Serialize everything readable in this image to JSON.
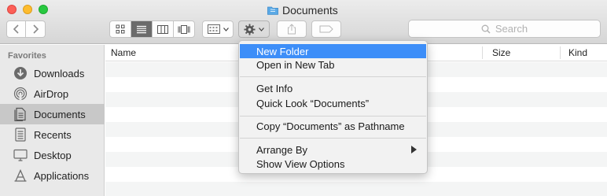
{
  "window": {
    "title": "Documents",
    "colors": {
      "close": "#fc5f57",
      "minimize": "#fdbc2e",
      "maximize": "#28c840",
      "accent": "#3d8ef8",
      "folder": "#5aa9e6"
    }
  },
  "toolbar": {
    "back_icon": "chevron-left-icon",
    "forward_icon": "chevron-right-icon",
    "view_modes": [
      "icon-view",
      "list-view",
      "column-view",
      "cover-flow-view"
    ],
    "active_view": "list-view",
    "group_icon": "group-grid-icon",
    "action_icon": "gear-icon",
    "share_icon": "share-icon",
    "tag_icon": "tag-icon"
  },
  "search": {
    "placeholder": "Search",
    "icon": "search-icon"
  },
  "sidebar": {
    "heading": "Favorites",
    "items": [
      {
        "label": "Downloads",
        "icon": "downloads-icon",
        "selected": false
      },
      {
        "label": "AirDrop",
        "icon": "airdrop-icon",
        "selected": false
      },
      {
        "label": "Documents",
        "icon": "documents-icon",
        "selected": true
      },
      {
        "label": "Recents",
        "icon": "recents-icon",
        "selected": false
      },
      {
        "label": "Desktop",
        "icon": "desktop-icon",
        "selected": false
      },
      {
        "label": "Applications",
        "icon": "applications-icon",
        "selected": false
      }
    ]
  },
  "list": {
    "columns": [
      "Name",
      "Size",
      "Kind"
    ]
  },
  "context_menu": {
    "items": [
      {
        "label": "New Folder",
        "highlighted": true
      },
      {
        "label": "Open in New Tab"
      },
      {
        "label": "Get Info"
      },
      {
        "label": "Quick Look “Documents”"
      },
      {
        "label": "Copy “Documents” as Pathname"
      },
      {
        "label": "Arrange By",
        "submenu": true
      },
      {
        "label": "Show View Options"
      }
    ]
  }
}
